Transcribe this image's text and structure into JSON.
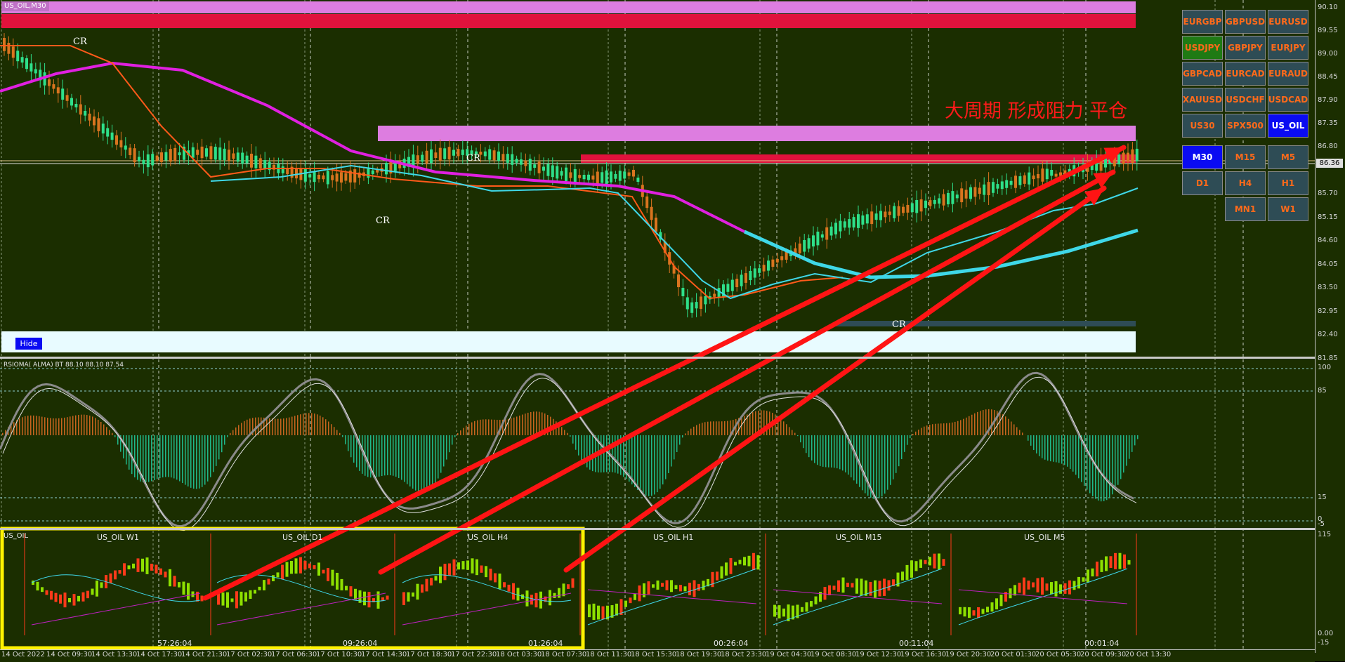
{
  "window": {
    "title": "US_OIL,M30"
  },
  "annotation_text": "大周期 形成阻力 平仓",
  "price_axis": {
    "labels": [
      "90.10",
      "89.55",
      "89.00",
      "88.45",
      "87.90",
      "87.35",
      "86.80",
      "86.36",
      "85.70",
      "85.15",
      "84.60",
      "84.05",
      "83.50",
      "82.95",
      "82.40",
      "81.85"
    ],
    "current_price": "86.36"
  },
  "indicator_axis": {
    "labels": [
      "100",
      "85",
      "15",
      "0",
      "-5"
    ]
  },
  "mini_axis": {
    "labels": [
      "115",
      "0.00",
      "-15"
    ]
  },
  "time_axis": {
    "labels": [
      "14 Oct 2022",
      "14 Oct 09:30",
      "14 Oct 13:30",
      "14 Oct 17:30",
      "14 Oct 21:30",
      "17 Oct 02:30",
      "17 Oct 06:30",
      "17 Oct 10:30",
      "17 Oct 14:30",
      "17 Oct 18:30",
      "17 Oct 22:30",
      "18 Oct 03:30",
      "18 Oct 07:30",
      "18 Oct 11:30",
      "18 Oct 15:30",
      "18 Oct 19:30",
      "18 Oct 23:30",
      "19 Oct 04:30",
      "19 Oct 08:30",
      "19 Oct 12:30",
      "19 Oct 16:30",
      "19 Oct 20:30",
      "20 Oct 01:30",
      "20 Oct 05:30",
      "20 Oct 09:30",
      "20 Oct 13:30"
    ]
  },
  "symbols": [
    "EURGBP",
    "GBPUSD",
    "EURUSD",
    "USDJPY",
    "GBPJPY",
    "EURJPY",
    "GBPCAD",
    "EURCAD",
    "EURAUD",
    "XAUUSD",
    "USDCHF",
    "USDCAD",
    "US30",
    "SPX500",
    "US_OIL"
  ],
  "active_symbol": "US_OIL",
  "timeframes": [
    "M30",
    "M15",
    "M5",
    "D1",
    "H4",
    "H1",
    "MN1",
    "W1"
  ],
  "active_timeframe": "M30",
  "hide_button": "Hide",
  "indicator": {
    "label": "RSIOMA( ALMA) BT  88.10 88.10 87.54"
  },
  "subcharts": {
    "corner_label": "US_OIL",
    "titles": [
      "US_OIL W1",
      "US_OIL D1",
      "US_OIL H4",
      "US_OIL H1",
      "US_OIL M15",
      "US_OIL M5"
    ],
    "timers": [
      "57:26:04",
      "09:26:04",
      "01:26:04",
      "00:26:04",
      "00:11:04",
      "00:01:04"
    ]
  },
  "colors": {
    "background": "#1b2e00",
    "bull": "#2ee08a",
    "bear": "#d9741f",
    "ma_fast": "#ff5a1a",
    "ma_slow": "#e020e0",
    "ma_cyan": "#3fd8e8",
    "resistance_zone": "#dd7de0",
    "red_zone": "#e0123c",
    "support_zone": "#e8fbff",
    "arrow": "#ff1414",
    "highlight_box": "#fff200"
  }
}
